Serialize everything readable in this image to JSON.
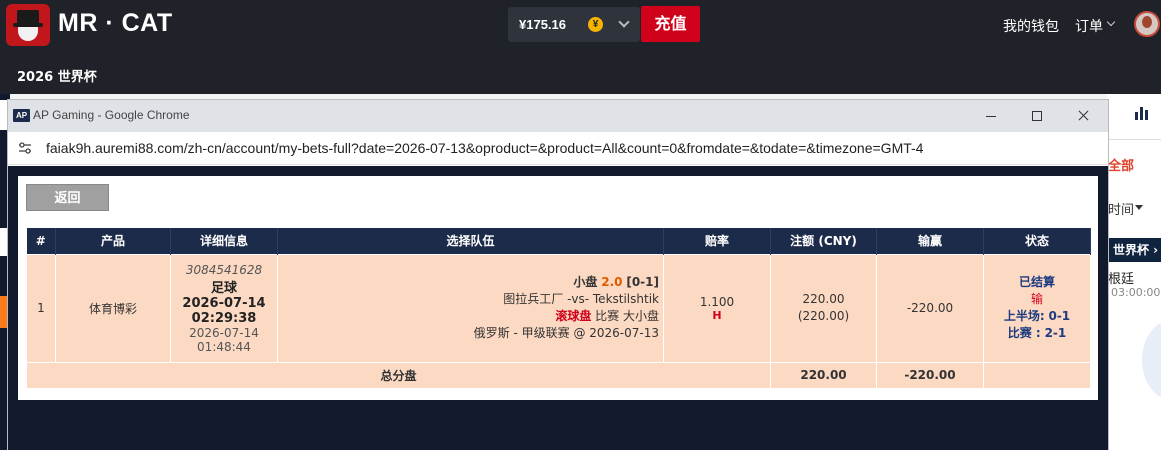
{
  "site": {
    "brand": "MR · CAT",
    "balance": "¥175.16",
    "coin_symbol": "¥",
    "deposit_label": "充值",
    "wallet_label": "我的钱包",
    "orders_label": "订单",
    "subnav_label": "2026 世界杯"
  },
  "background": {
    "all_label": "全部",
    "time_label": "时间",
    "worldcup_label": "世界杯 ›",
    "match_text": "根廷",
    "match_time": "03:00:00"
  },
  "chrome": {
    "badge": "AP",
    "title": "AP Gaming - Google Chrome",
    "url": "faiak9h.auremi88.com/zh-cn/account/my-bets-full?date=2026-07-13&oproduct=&product=All&count=0&fromdate=&todate=&timezone=GMT-4"
  },
  "bets": {
    "back_label": "返回",
    "columns": [
      "#",
      "产品",
      "详细信息",
      "选择队伍",
      "赔率",
      "注额 (CNY)",
      "输赢",
      "状态"
    ],
    "row": {
      "index": "1",
      "product": "体育博彩",
      "bet_id": "3084541628",
      "sport": "足球",
      "event_date": "2026-07-14",
      "event_time": "02:29:38",
      "placed_date": "2026-07-14",
      "placed_time": "01:48:44",
      "selection_market": "小盘",
      "selection_line": "2.0",
      "selection_score": "[0-1]",
      "selection_teams": "图拉兵工厂 -vs- Tekstilshtik",
      "selection_type_live": "滚球盘",
      "selection_type_rest": "比赛 大小盘",
      "selection_league": "俄罗斯 - 甲级联赛 @ 2026-07-13",
      "odds": "1.100",
      "odds_type": "H",
      "stake": "220.00",
      "stake_actual": "(220.00)",
      "win_loss": "-220.00",
      "status": "已结算",
      "result": "输",
      "half_label": "上半场:",
      "half_score": "0-1",
      "full_label": "比赛 :",
      "full_score": "2-1"
    },
    "total": {
      "label": "总分盘",
      "stake": "220.00",
      "win_loss": "-220.00"
    }
  },
  "colors": {
    "header_bg": "#1f2329",
    "deposit": "#d0021b",
    "table_header": "#1d2b4a",
    "row_bg": "#fcd9c3",
    "total_bg": "#e8e8e8",
    "status_blue": "#1d3b80"
  },
  "icons": {
    "logo": "mr-cat-logo",
    "coin": "yuan-coin-icon",
    "avatar": "user-avatar",
    "tune": "site-info-icon",
    "chart": "bar-chart-icon"
  }
}
